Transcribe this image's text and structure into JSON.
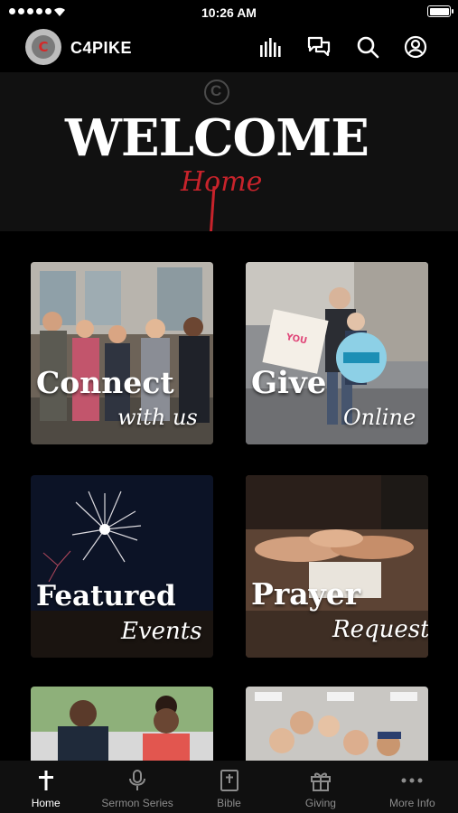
{
  "status_bar": {
    "time": "10:26 AM"
  },
  "header": {
    "app_name": "C4PIKE",
    "logo_letter": "C",
    "icons": [
      "equalizer-icon",
      "chat-icon",
      "search-icon",
      "profile-icon"
    ]
  },
  "hero": {
    "title": "WELCOME",
    "script": "Home"
  },
  "tiles": [
    {
      "main": "Connect",
      "script": "with us"
    },
    {
      "main": "Give",
      "script": "Online"
    },
    {
      "main": "Featured",
      "script": "Events"
    },
    {
      "main": "Prayer",
      "script": "Request"
    }
  ],
  "tabs": [
    {
      "label": "Home",
      "icon": "cross-icon",
      "active": true
    },
    {
      "label": "Sermon Series",
      "icon": "microphone-icon"
    },
    {
      "label": "Bible",
      "icon": "bible-icon"
    },
    {
      "label": "Giving",
      "icon": "gift-icon"
    },
    {
      "label": "More Info",
      "icon": "more-icon"
    }
  ],
  "colors": {
    "accent_red": "#c7232b",
    "background": "#000000",
    "tab_inactive": "#8c8c8c"
  }
}
